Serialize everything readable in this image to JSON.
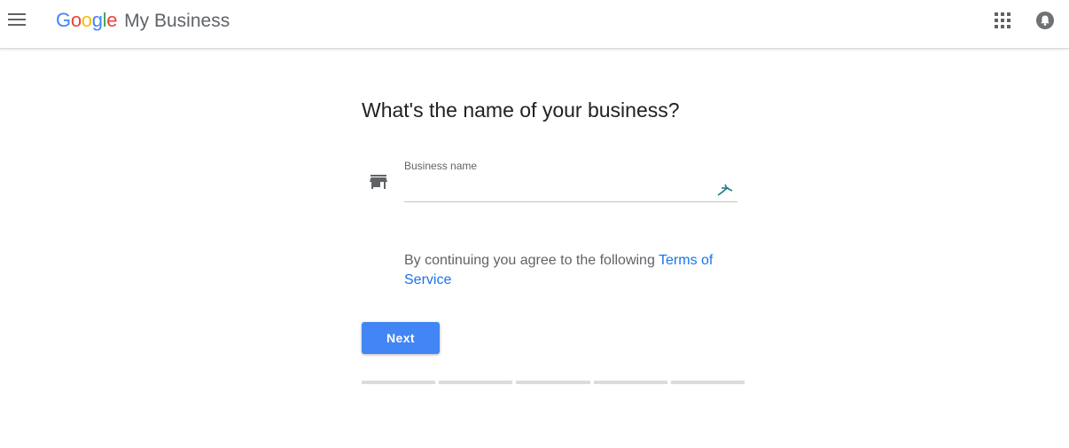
{
  "header": {
    "logo_letters": [
      {
        "ch": "G",
        "color": "#4285F4"
      },
      {
        "ch": "o",
        "color": "#EA4335"
      },
      {
        "ch": "o",
        "color": "#FBBC05"
      },
      {
        "ch": "g",
        "color": "#4285F4"
      },
      {
        "ch": "l",
        "color": "#34A853"
      },
      {
        "ch": "e",
        "color": "#EA4335"
      }
    ],
    "product_name": "My Business",
    "menu_icon": "hamburger-menu-icon",
    "apps_icon": "apps-grid-icon",
    "account_icon": "account-bell-icon"
  },
  "main": {
    "title": "What's the name of your business?",
    "field": {
      "label": "Business name",
      "value": "",
      "placeholder": "",
      "leading_icon": "storefront-icon",
      "trailing_icon": "autofill-extension-icon"
    },
    "terms": {
      "prefix": "By continuing you agree to the following ",
      "link": "Terms of Service"
    },
    "next_label": "Next",
    "progress": {
      "steps": 5,
      "completed": 0
    }
  },
  "colors": {
    "primary": "#4285F4",
    "link": "#1A73E8",
    "text": "#202124",
    "muted": "#5F6368"
  }
}
